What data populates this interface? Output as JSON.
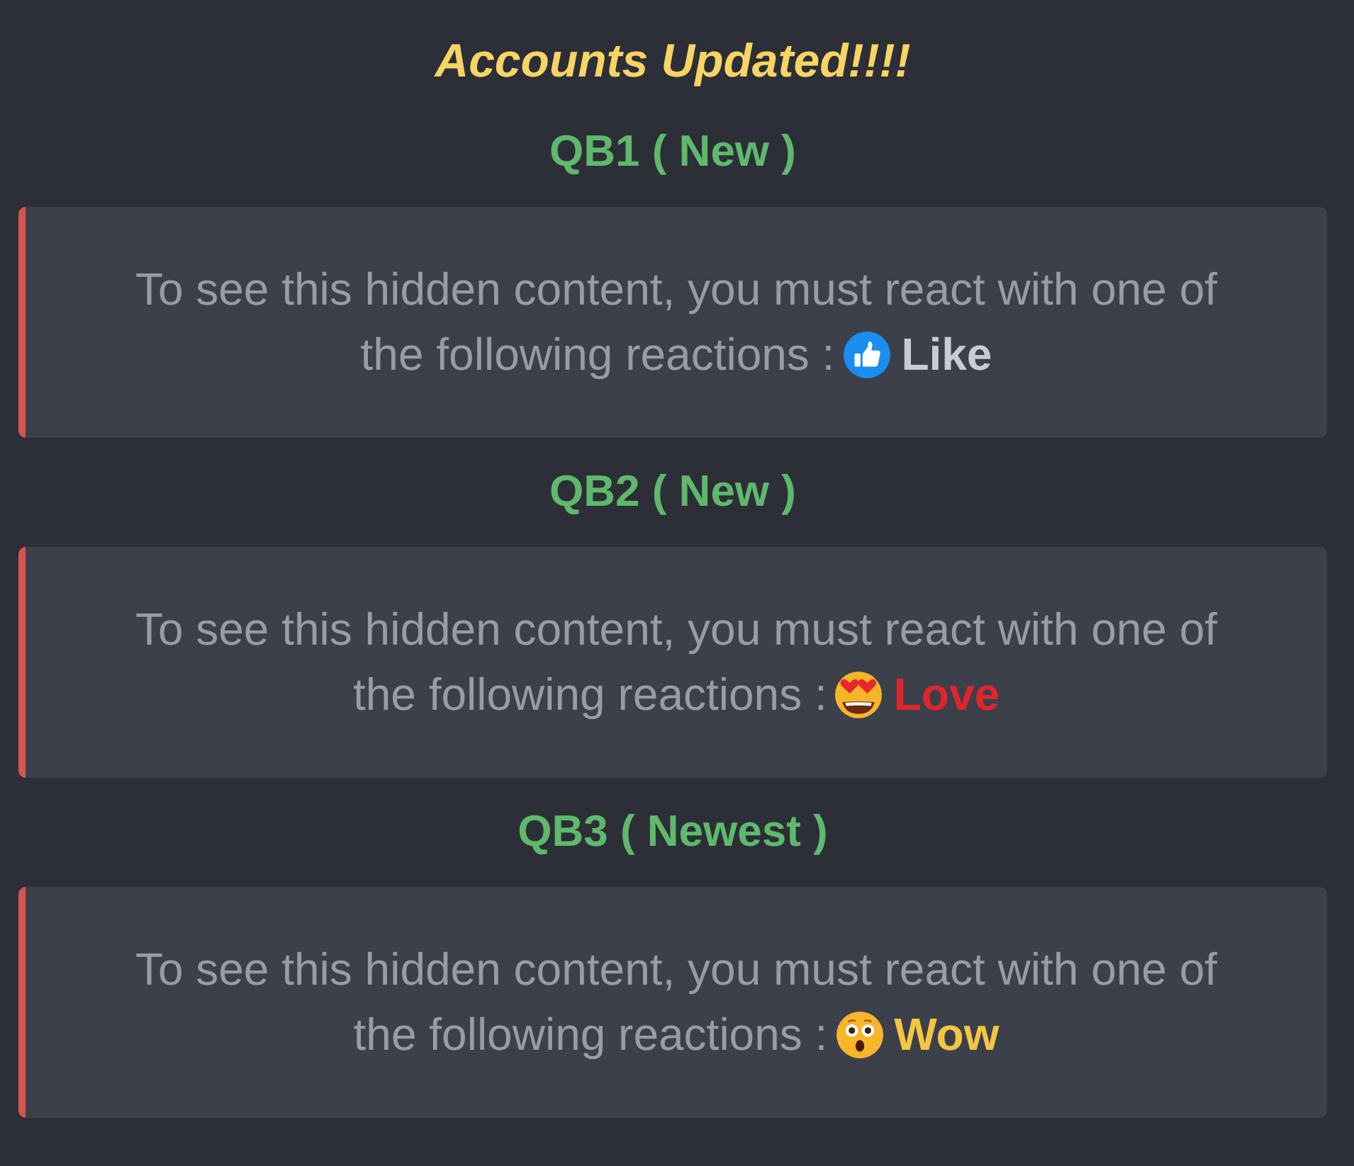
{
  "title": "Accounts Updated!!!!",
  "sections": [
    {
      "heading": "QB1 ( New )",
      "notice": {
        "text": "To see this hidden content, you must react with one of the following reactions :",
        "reaction": {
          "kind": "like",
          "label": "Like",
          "color": "#c8ccd5"
        }
      }
    },
    {
      "heading": "QB2 ( New )",
      "notice": {
        "text": "To see this hidden content, you must react with one of the following reactions :",
        "reaction": {
          "kind": "love",
          "label": "Love",
          "color": "#e0262c"
        }
      }
    },
    {
      "heading": "QB3 ( Newest )",
      "notice": {
        "text": "To see this hidden content, you must react with one of the following reactions :",
        "reaction": {
          "kind": "wow",
          "label": "Wow",
          "color": "#f4c542"
        }
      }
    }
  ]
}
